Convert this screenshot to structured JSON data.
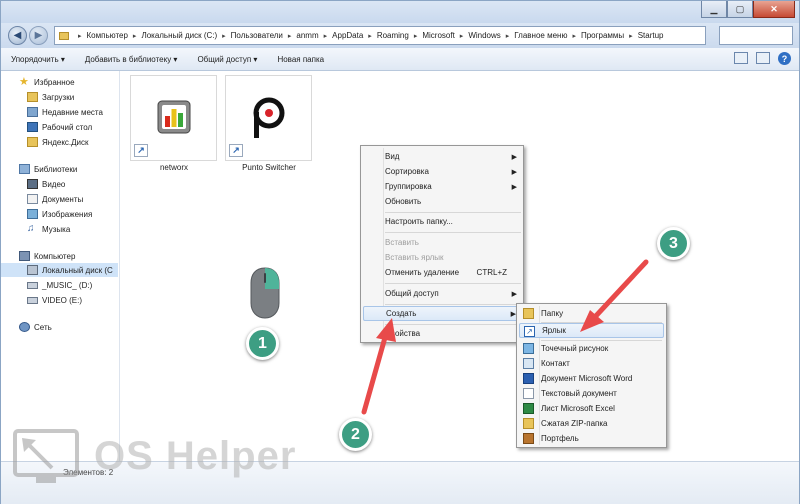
{
  "breadcrumbs": [
    "Компьютер",
    "Локальный диск (C:)",
    "Пользователи",
    "anmm",
    "AppData",
    "Roaming",
    "Microsoft",
    "Windows",
    "Главное меню",
    "Программы",
    "Startup"
  ],
  "toolbar": {
    "organize": "Упорядочить ▾",
    "add_library": "Добавить в библиотеку ▾",
    "share": "Общий доступ ▾",
    "new_folder": "Новая папка"
  },
  "nav": {
    "favorites": "Избранное",
    "downloads": "Загрузки",
    "recent": "Недавние места",
    "desktop": "Рабочий стол",
    "yadisk": "Яндекс.Диск",
    "libraries": "Библиотеки",
    "video": "Видео",
    "docs": "Документы",
    "images": "Изображения",
    "music": "Музыка",
    "computer": "Компьютер",
    "local_c": "Локальный диск (C",
    "music_d": "_MUSIC_ (D:)",
    "video_e": "VIDEO (E:)",
    "network": "Сеть"
  },
  "files": [
    "networx",
    "Punto Switcher"
  ],
  "status": "Элементов: 2",
  "context_menu": {
    "view": "Вид",
    "sort": "Сортировка",
    "group": "Группировка",
    "refresh": "Обновить",
    "customize": "Настроить папку...",
    "paste": "Вставить",
    "paste_shortcut": "Вставить ярлык",
    "undo": "Отменить удаление",
    "undo_key": "CTRL+Z",
    "share": "Общий доступ",
    "create": "Создать",
    "properties": "Свойства"
  },
  "submenu": {
    "folder": "Папку",
    "shortcut": "Ярлык",
    "bitmap": "Точечный рисунок",
    "contact": "Контакт",
    "word": "Документ Microsoft Word",
    "text": "Текстовый документ",
    "excel": "Лист Microsoft Excel",
    "zip": "Сжатая ZIP-папка",
    "briefcase": "Портфель"
  },
  "steps": [
    "1",
    "2",
    "3"
  ],
  "watermark": "OS Helper",
  "colors": {
    "accent": "#3d9e83",
    "arrow": "#e84a4a"
  }
}
